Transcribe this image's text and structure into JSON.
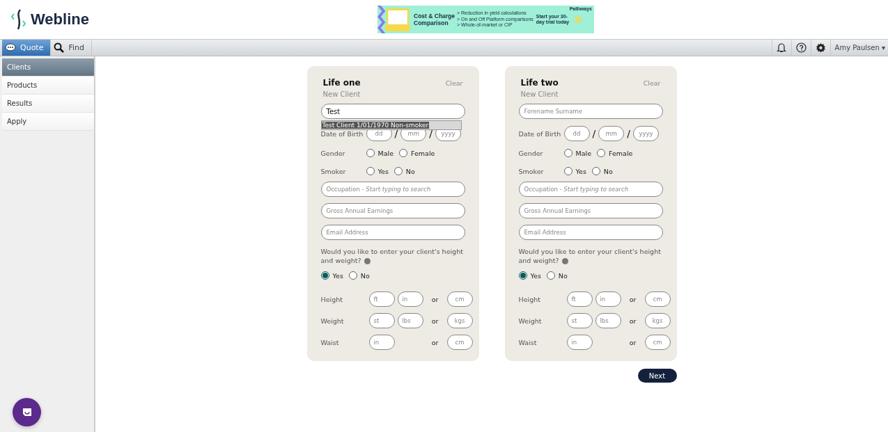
{
  "brand": "Webline",
  "banner": {
    "title": "Cost & Charge Comparison",
    "points": [
      "> Reduction in yield calculations",
      "> On and Off Platform comparisons",
      "> Whole-of-market or CIP"
    ],
    "cta": "Start your 30-day trial today",
    "sponsor": "Pathways"
  },
  "nav_tabs": [
    {
      "label": "Quote",
      "selected": true
    },
    {
      "label": "Find",
      "selected": false
    }
  ],
  "user": "Amy Paulsen ▾",
  "sidebar": [
    {
      "label": "Clients",
      "selected": true
    },
    {
      "label": "Products",
      "selected": false
    },
    {
      "label": "Results",
      "selected": false
    },
    {
      "label": "Apply",
      "selected": false
    }
  ],
  "lives": [
    {
      "title": "Life one",
      "clear": "Clear",
      "subtitle": "New Client",
      "name": {
        "value": "Test"
      },
      "suggestion": "Test Client 1/01/1970 Non-smoker",
      "dob_label": "Date of Birth",
      "dob": [
        "dd",
        "mm",
        "yyyy"
      ],
      "dob_sep": [
        "/",
        "/"
      ],
      "gender": {
        "label": "Gender",
        "options": [
          {
            "label": "Male",
            "selected": false
          },
          {
            "label": "Female",
            "selected": false
          }
        ]
      },
      "smoker": {
        "label": "Smoker",
        "options": [
          {
            "label": "Yes",
            "selected": false
          },
          {
            "label": "No",
            "selected": false
          }
        ]
      },
      "occupation": "Occupation - *Start typing to search*",
      "earnings": "Gross Annual Earnings",
      "email": "Email Address",
      "question": "Would you like to enter your client's height and weight?",
      "hw_options": [
        {
          "label": "Yes",
          "selected": true
        },
        {
          "label": "No",
          "selected": false
        }
      ],
      "measures": [
        {
          "label": "Height",
          "imperial": [
            "ft",
            "in"
          ],
          "or": "or",
          "metric": "cm"
        },
        {
          "label": "Weight",
          "imperial": [
            "st",
            "lbs"
          ],
          "or": "or",
          "metric": "kgs"
        },
        {
          "label": "Waist",
          "imperial": [
            "in"
          ],
          "or": "or",
          "metric": "cm"
        }
      ]
    },
    {
      "title": "Life two",
      "clear": "Clear",
      "subtitle": "New Client",
      "name": {
        "placeholder": "Forename Surname"
      },
      "dob_label": "Date of Birth",
      "dob": [
        "dd",
        "mm",
        "yyyy"
      ],
      "dob_sep": [
        "/",
        "/"
      ],
      "gender": {
        "label": "Gender",
        "options": [
          {
            "label": "Male",
            "selected": false
          },
          {
            "label": "Female",
            "selected": false
          }
        ]
      },
      "smoker": {
        "label": "Smoker",
        "options": [
          {
            "label": "Yes",
            "selected": false
          },
          {
            "label": "No",
            "selected": false
          }
        ]
      },
      "occupation": "Occupation - *Start typing to search*",
      "earnings": "Gross Annual Earnings",
      "email": "Email Address",
      "question": "Would you like to enter your client's height and weight?",
      "hw_options": [
        {
          "label": "Yes",
          "selected": true
        },
        {
          "label": "No",
          "selected": false
        }
      ],
      "measures": [
        {
          "label": "Height",
          "imperial": [
            "ft",
            "in"
          ],
          "or": "or",
          "metric": "cm"
        },
        {
          "label": "Weight",
          "imperial": [
            "st",
            "lbs"
          ],
          "or": "or",
          "metric": "kgs"
        },
        {
          "label": "Waist",
          "imperial": [
            "in"
          ],
          "or": "or",
          "metric": "cm"
        }
      ]
    }
  ],
  "next": "Next"
}
